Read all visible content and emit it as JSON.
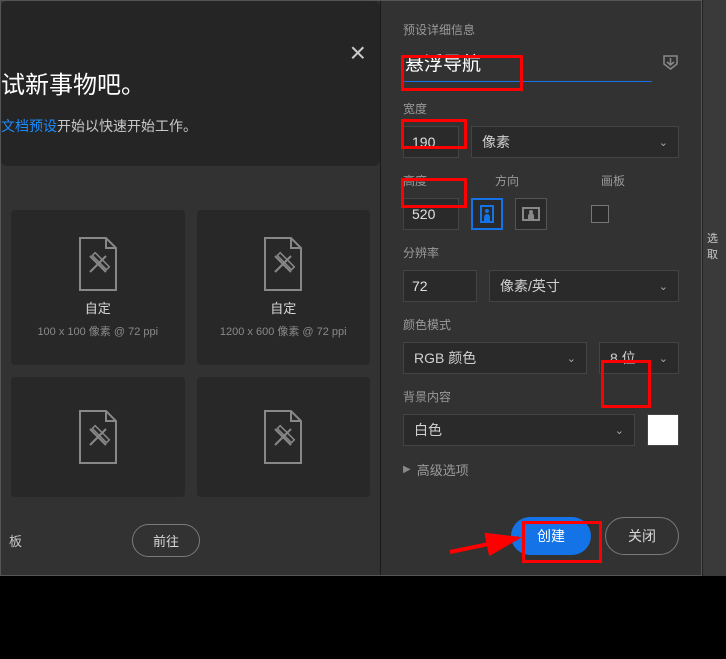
{
  "left": {
    "headline": "试新事物吧。",
    "subline_link": "文档预设",
    "subline_rest": "开始以快速开始工作。",
    "bottom_label": "板",
    "goto_label": "前往"
  },
  "presets": [
    {
      "name": "自定",
      "sub": "100 x 100 像素 @ 72 ppi"
    },
    {
      "name": "自定",
      "sub": "1200 x 600 像素 @ 72 ppi"
    },
    {
      "name": "",
      "sub": ""
    },
    {
      "name": "",
      "sub": ""
    }
  ],
  "right": {
    "header": "预设详细信息",
    "name_value": "悬浮导航",
    "width_label": "宽度",
    "width_value": "190",
    "width_unit": "像素",
    "height_label": "高度",
    "height_value": "520",
    "orient_label": "方向",
    "artboard_label": "画板",
    "res_label": "分辨率",
    "res_value": "72",
    "res_unit": "像素/英寸",
    "mode_label": "颜色模式",
    "mode_value": "RGB 颜色",
    "depth_value": "8 位",
    "bg_label": "背景内容",
    "bg_value": "白色",
    "advanced": "高级选项",
    "create": "创建",
    "close": "关闭"
  },
  "strip": {
    "label": "选取"
  },
  "icons": {
    "close_x": "×",
    "download": "⬇",
    "chevron": "⌄",
    "tri_right": "▶"
  }
}
